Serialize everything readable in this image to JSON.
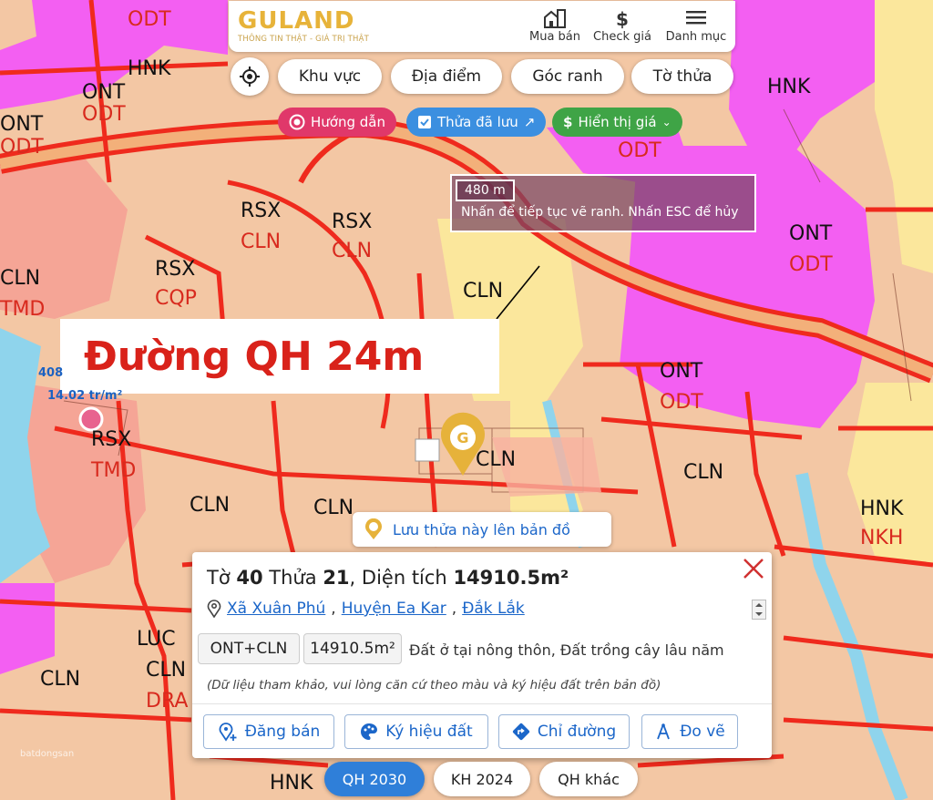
{
  "brand": {
    "name": "GULAND",
    "tagline": "THÔNG TIN THẬT - GIÁ TRỊ THẬT"
  },
  "nav": [
    {
      "label": "Mua bán",
      "icon": "building-icon"
    },
    {
      "label": "Check giá",
      "icon": "dollar-icon"
    },
    {
      "label": "Danh mục",
      "icon": "menu-icon"
    }
  ],
  "filters": [
    "Khu vực",
    "Địa điểm",
    "Góc ranh",
    "Tờ thửa"
  ],
  "pills": {
    "guide": "Hướng dẫn",
    "saved": "Thửa đã lưu",
    "price": "Hiển thị giá"
  },
  "measure": {
    "distance": "480 m",
    "hint": "Nhấn để tiếp tục vẽ ranh. Nhấn ESC để hủy"
  },
  "overlay_label": "Đường QH 24m",
  "side_labels": {
    "a": "408",
    "b": "14.02 tr/m²"
  },
  "save_button": "Lưu thửa này lên bản đồ",
  "zones": [
    "ODT",
    "HNK",
    "ONT",
    "ODT",
    "ONT",
    "ODT",
    "HNK",
    "ODT",
    "ONT",
    "ODT",
    "RSX",
    "CLN",
    "RSX",
    "CLN",
    "RSX",
    "CQP",
    "CLN",
    "TMD",
    "CLN",
    "ONT",
    "ODT",
    "RSX",
    "TMD",
    "CLN",
    "CLN",
    "CLN",
    "CLN",
    "HNK",
    "NKH",
    "LUC",
    "CLN",
    "DRA",
    "CLN",
    "HNK"
  ],
  "parcel": {
    "sheet_label": "Tờ",
    "sheet": "40",
    "plot_label": "Thửa",
    "plot": "21",
    "area_label": "Diện tích",
    "area": "14910.5m²",
    "location": [
      "Xã Xuân Phú",
      "Huyện Ea Kar",
      "Đắk Lắk"
    ],
    "land_code": "ONT+CLN",
    "land_area": "14910.5m²",
    "land_desc": "Đất ở tại nông thôn, Đất trồng cây lâu năm",
    "note": "(Dữ liệu tham khảo, vui lòng căn cứ theo màu và ký hiệu đất trên bản đồ)"
  },
  "actions": [
    "Đăng bán",
    "Ký hiệu đất",
    "Chỉ đường",
    "Đo vẽ"
  ],
  "plan_tabs": [
    "QH 2030",
    "KH 2024",
    "QH khác"
  ],
  "watermark": "batdongsan",
  "colors": {
    "brand_gold": "#e7b339",
    "pill_guide": "#e0386a",
    "pill_saved": "#3b8fe0",
    "pill_price": "#3fa446",
    "link_blue": "#1b66c9",
    "overlay_red": "#d9221a",
    "zone_pink": "#f35ff2",
    "zone_orange": "#f4c4a0",
    "zone_yellow": "#fbe79c",
    "road_red": "#ef2a1d",
    "active_tab": "#2f7fd9"
  }
}
